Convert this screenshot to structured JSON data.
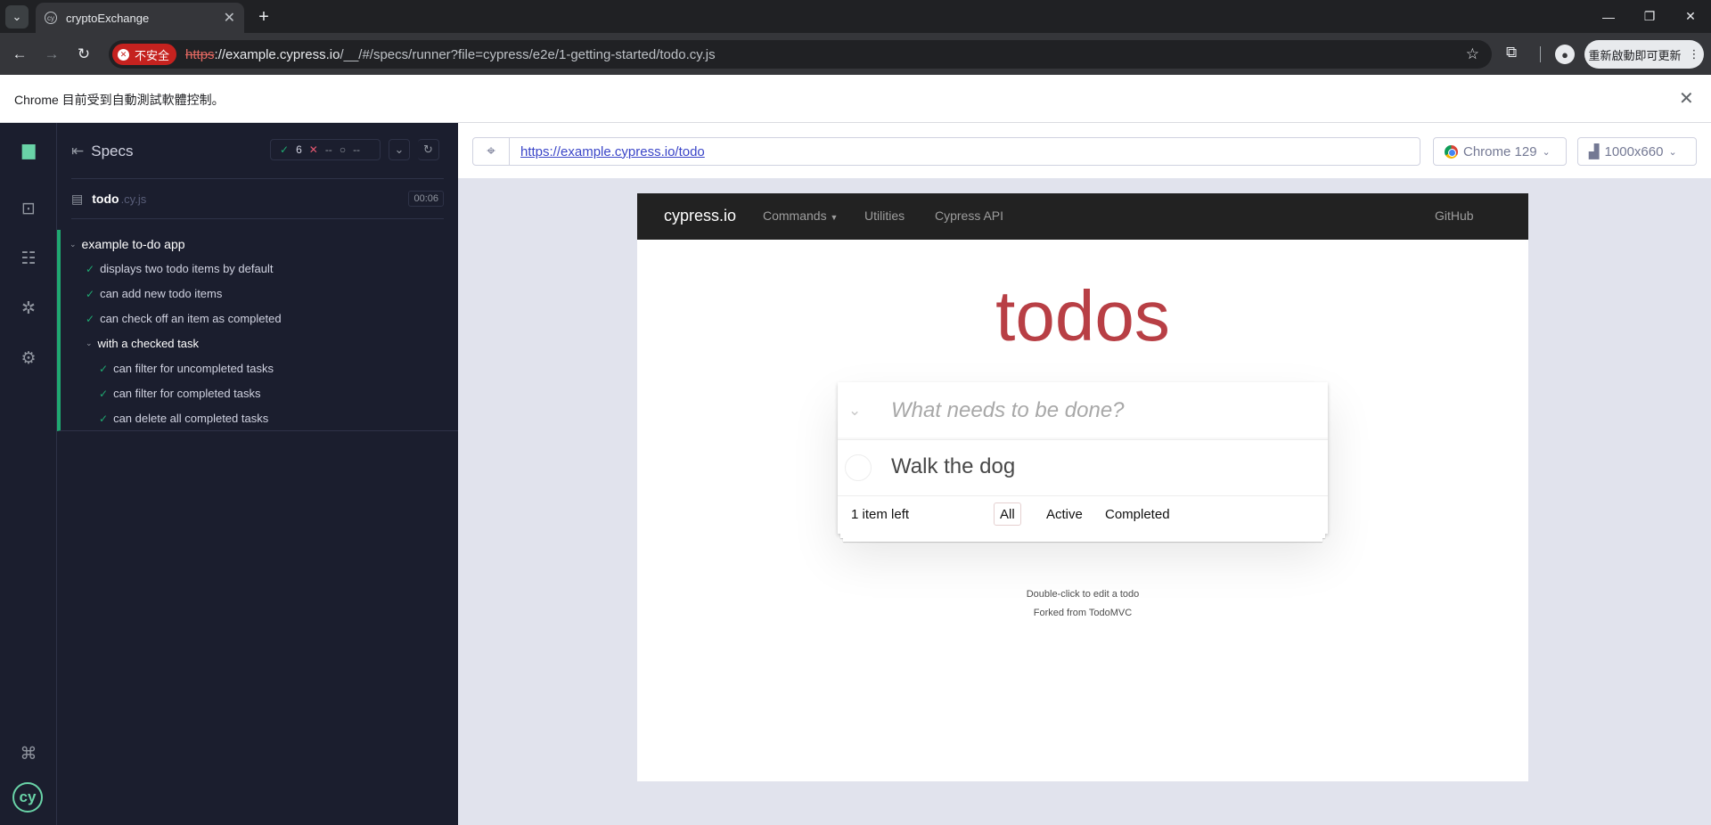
{
  "browser": {
    "tab_title": "cryptoExchange",
    "insecure_label": "不安全",
    "url_scheme": "https",
    "url_host": "://example.cypress.io",
    "url_rest": "/__/#/specs/runner?file=cypress/e2e/1-getting-started/todo.cy.js",
    "relaunch_label": "重新啟動即可更新",
    "infobar_text": "Chrome 目前受到自動測試軟體控制。"
  },
  "reporter": {
    "specs_label": "Specs",
    "passed": "6",
    "failed": "--",
    "pending": "--",
    "spec_name": "todo",
    "spec_ext": ".cy.js",
    "duration": "00:06",
    "suite_title": "example to-do app",
    "tests": [
      "displays two todo items by default",
      "can add new todo items",
      "can check off an item as completed"
    ],
    "nested_suite_title": "with a checked task",
    "nested_tests": [
      "can filter for uncompleted tasks",
      "can filter for completed tasks",
      "can delete all completed tasks"
    ]
  },
  "aut_header": {
    "url": "https://example.cypress.io/todo",
    "browser": "Chrome 129",
    "viewport": "1000x660"
  },
  "aut": {
    "brand": "cypress.io",
    "nav": [
      "Commands",
      "Utilities",
      "Cypress API"
    ],
    "github": "GitHub",
    "heading": "todos",
    "placeholder": "What needs to be done?",
    "todo_item": "Walk the dog",
    "count_num": "1",
    "count_text": " item left",
    "filters": [
      "All",
      "Active",
      "Completed"
    ],
    "info_line1": "Double-click to edit a todo",
    "info_line2": "Forked from TodoMVC"
  }
}
